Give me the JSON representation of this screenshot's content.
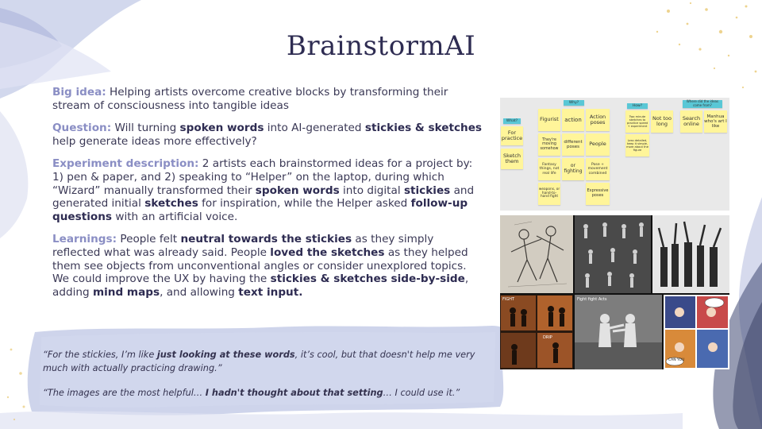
{
  "title": "BrainstormAI",
  "big_idea": {
    "label": "Big idea:",
    "text": " Helping artists overcome creative blocks by transforming their stream of consciousness into tangible ideas"
  },
  "question": {
    "label": "Question:",
    "t1": " Will turning ",
    "b1": "spoken words",
    "t2": " into AI-generated ",
    "b2": "stickies & sketches",
    "t3": " help generate ideas more effectively?"
  },
  "experiment": {
    "label": "Experiment description:",
    "t1": " 2 artists each brainstormed ideas for a project by: 1) pen & paper, and 2) speaking to “Helper” on the laptop, during which “Wizard” manually transformed their ",
    "b1": "spoken words",
    "t2": " into digital ",
    "b2": "stickies",
    "t3": " and generated initial ",
    "b3": "sketches",
    "t4": " for inspiration, while the Helper asked ",
    "b4": "follow-up questions",
    "t5": " with an artificial voice."
  },
  "learnings": {
    "label": "Learnings:",
    "t1": " People felt ",
    "b1": "neutral towards the stickies",
    "t2": " as they simply reflected what was already said. People ",
    "b2": "loved the sketches",
    "t3": " as they helped them see objects from unconventional angles or consider unexplored topics. We could improve the UX by having the ",
    "b3": "stickies & sketches side-by-side",
    "t4": ", adding ",
    "b4": "mind maps",
    "t5": ", and allowing ",
    "b5": "text input.",
    "t6": ""
  },
  "quotes": [
    {
      "t1": "“For the stickies, I’m like ",
      "b1": "just looking at these words",
      "t2": ", it’s cool, but that doesn't help me very much with actually practicing drawing.”"
    },
    {
      "t1": "“The images are the most helpful… ",
      "b1": "I hadn't thought about that setting",
      "t2": "… I could use it.”"
    }
  ],
  "stickies_image": {
    "headers": [
      "What?",
      "Why?",
      "How?",
      "Where did the ideas come from?"
    ],
    "notes": {
      "n1": "For practice",
      "n2": "Sketch them",
      "n3": "Figurist",
      "n4": "action",
      "n5": "Action poses",
      "n6": "They're moving somehow",
      "n7": "different poses",
      "n8": "People",
      "n9": "Fantasy things, not real life",
      "n10": "or fighting",
      "n11": "Pose + movement combined",
      "n12": "weapons, or hand-to-hand fight",
      "n13": "Expressive poses",
      "n14": "Two minute sketches to practice speed + experiment",
      "n15": "Not too long",
      "n16": "Less detailed, keep it simple, more about the figure",
      "n17": "Search online",
      "n18": "Manhua who's art I like"
    }
  },
  "sketches_image": {
    "labels": [
      "FIGHT",
      "Fight fight Acts",
      "DRIP",
      "CAN YOU"
    ]
  },
  "colors": {
    "title": "#2e2c52",
    "label": "#8a8ec4",
    "text": "#3a3855",
    "wash": "#c6cde8",
    "sticky": "#fff59a",
    "sticky_header": "#59c7d6",
    "gold": "#e8c56a"
  }
}
